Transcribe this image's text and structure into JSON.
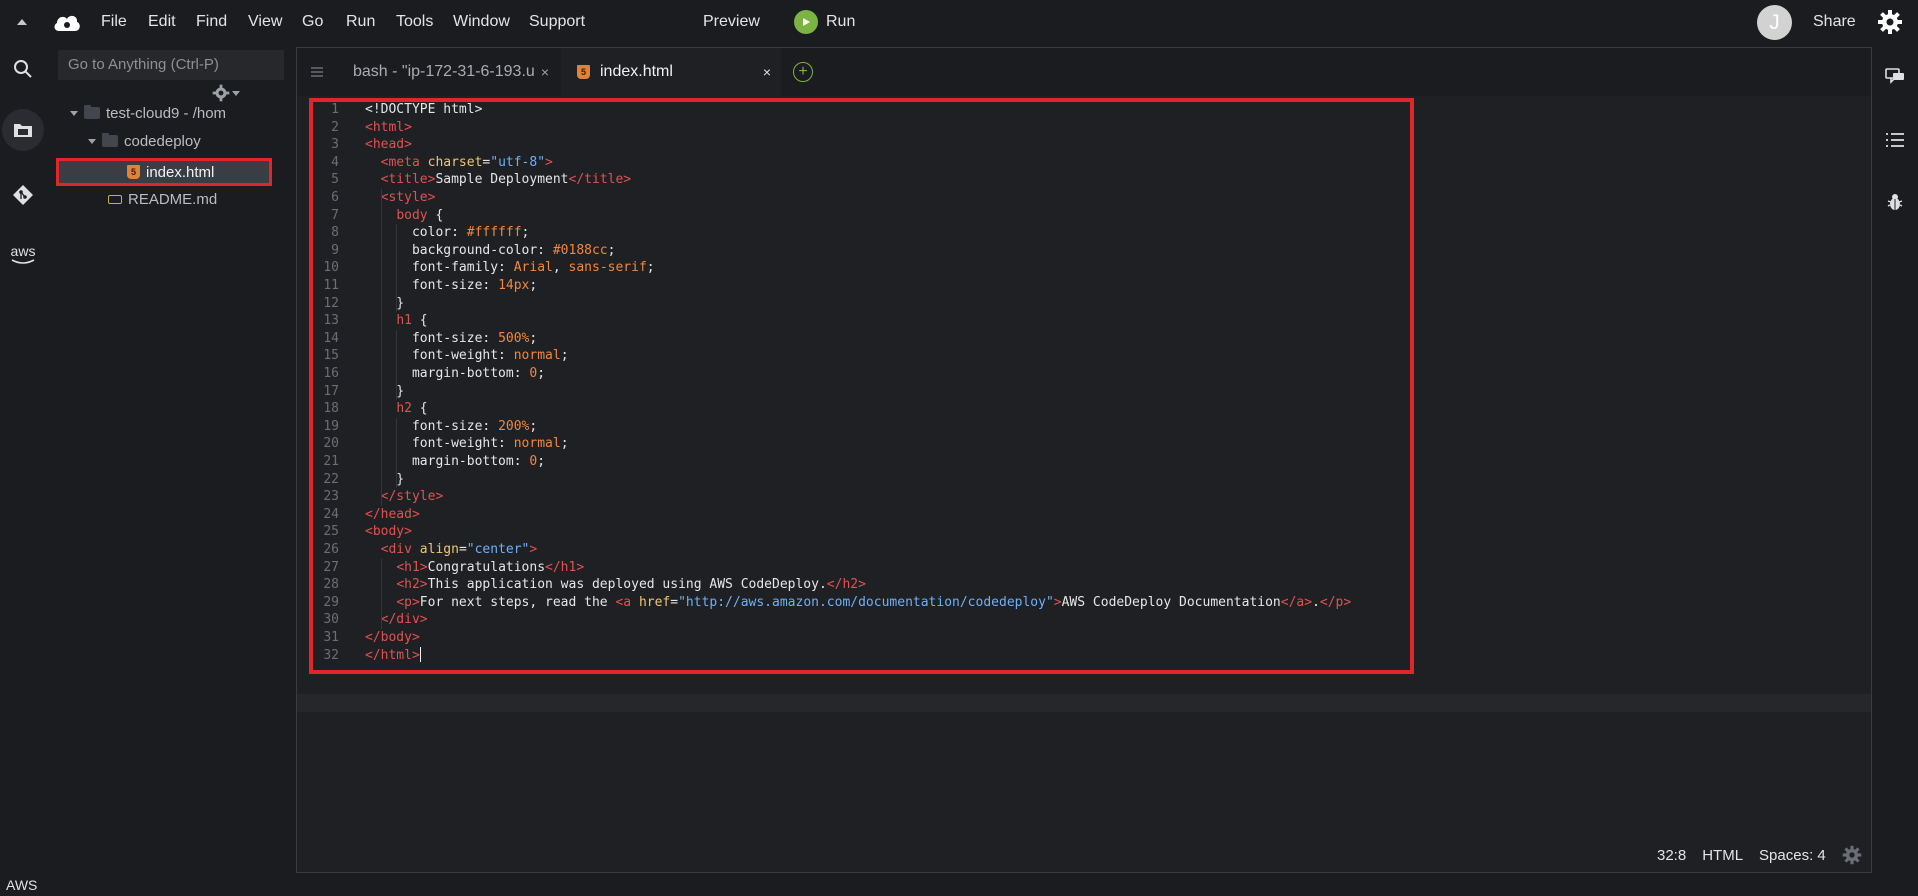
{
  "menubar": {
    "items": [
      "File",
      "Edit",
      "Find",
      "View",
      "Go",
      "Run",
      "Tools",
      "Window",
      "Support"
    ],
    "preview_label": "Preview",
    "run_label": "Run",
    "avatar_initial": "J",
    "share_label": "Share"
  },
  "tree": {
    "goto_placeholder": "Go to Anything (Ctrl-P)",
    "root_label": "test-cloud9 - /hom",
    "folder_label": "codedeploy",
    "file_selected": "index.html",
    "file_other": "README.md"
  },
  "tabs": {
    "bash_label": "bash - \"ip-172-31-6-193.u",
    "index_label": "index.html",
    "close_glyph": "×",
    "add_glyph": "+"
  },
  "code": {
    "line_numbers": [
      "1",
      "2",
      "3",
      "4",
      "5",
      "6",
      "7",
      "8",
      "9",
      "10",
      "11",
      "12",
      "13",
      "14",
      "15",
      "16",
      "17",
      "18",
      "19",
      "20",
      "21",
      "22",
      "23",
      "24",
      "25",
      "26",
      "27",
      "28",
      "29",
      "30",
      "31",
      "32"
    ],
    "lines": [
      [
        {
          "t": "plain",
          "v": "<!DOCTYPE html>"
        }
      ],
      [
        {
          "t": "tag",
          "v": "<html>"
        }
      ],
      [
        {
          "t": "tag",
          "v": "<head>"
        }
      ],
      [
        {
          "t": "plain",
          "v": "  "
        },
        {
          "t": "tag",
          "v": "<meta "
        },
        {
          "t": "attr",
          "v": "charset"
        },
        {
          "t": "plain",
          "v": "="
        },
        {
          "t": "str",
          "v": "\"utf-8\""
        },
        {
          "t": "tag",
          "v": ">"
        }
      ],
      [
        {
          "t": "plain",
          "v": "  "
        },
        {
          "t": "tag",
          "v": "<title>"
        },
        {
          "t": "plain",
          "v": "Sample Deployment"
        },
        {
          "t": "tag",
          "v": "</title>"
        }
      ],
      [
        {
          "t": "plain",
          "v": "  "
        },
        {
          "t": "tag",
          "v": "<style>"
        }
      ],
      [
        {
          "t": "plain",
          "v": "    "
        },
        {
          "t": "tag",
          "v": "body"
        },
        {
          "t": "plain",
          "v": " {"
        }
      ],
      [
        {
          "t": "plain",
          "v": "      color: "
        },
        {
          "t": "num",
          "v": "#ffffff"
        },
        {
          "t": "plain",
          "v": ";"
        }
      ],
      [
        {
          "t": "plain",
          "v": "      background-color: "
        },
        {
          "t": "num",
          "v": "#0188cc"
        },
        {
          "t": "plain",
          "v": ";"
        }
      ],
      [
        {
          "t": "plain",
          "v": "      font-family: "
        },
        {
          "t": "num",
          "v": "Arial"
        },
        {
          "t": "plain",
          "v": ", "
        },
        {
          "t": "num",
          "v": "sans-serif"
        },
        {
          "t": "plain",
          "v": ";"
        }
      ],
      [
        {
          "t": "plain",
          "v": "      font-size: "
        },
        {
          "t": "num",
          "v": "14px"
        },
        {
          "t": "plain",
          "v": ";"
        }
      ],
      [
        {
          "t": "plain",
          "v": "    }"
        }
      ],
      [
        {
          "t": "plain",
          "v": "    "
        },
        {
          "t": "tag",
          "v": "h1"
        },
        {
          "t": "plain",
          "v": " {"
        }
      ],
      [
        {
          "t": "plain",
          "v": "      font-size: "
        },
        {
          "t": "num",
          "v": "500%"
        },
        {
          "t": "plain",
          "v": ";"
        }
      ],
      [
        {
          "t": "plain",
          "v": "      font-weight: "
        },
        {
          "t": "num",
          "v": "normal"
        },
        {
          "t": "plain",
          "v": ";"
        }
      ],
      [
        {
          "t": "plain",
          "v": "      margin-bottom: "
        },
        {
          "t": "num",
          "v": "0"
        },
        {
          "t": "plain",
          "v": ";"
        }
      ],
      [
        {
          "t": "plain",
          "v": "    }"
        }
      ],
      [
        {
          "t": "plain",
          "v": "    "
        },
        {
          "t": "tag",
          "v": "h2"
        },
        {
          "t": "plain",
          "v": " {"
        }
      ],
      [
        {
          "t": "plain",
          "v": "      font-size: "
        },
        {
          "t": "num",
          "v": "200%"
        },
        {
          "t": "plain",
          "v": ";"
        }
      ],
      [
        {
          "t": "plain",
          "v": "      font-weight: "
        },
        {
          "t": "num",
          "v": "normal"
        },
        {
          "t": "plain",
          "v": ";"
        }
      ],
      [
        {
          "t": "plain",
          "v": "      margin-bottom: "
        },
        {
          "t": "num",
          "v": "0"
        },
        {
          "t": "plain",
          "v": ";"
        }
      ],
      [
        {
          "t": "plain",
          "v": "    }"
        }
      ],
      [
        {
          "t": "plain",
          "v": "  "
        },
        {
          "t": "tag",
          "v": "</style>"
        }
      ],
      [
        {
          "t": "tag",
          "v": "</head>"
        }
      ],
      [
        {
          "t": "tag",
          "v": "<body>"
        }
      ],
      [
        {
          "t": "plain",
          "v": "  "
        },
        {
          "t": "tag",
          "v": "<div "
        },
        {
          "t": "attr",
          "v": "align"
        },
        {
          "t": "plain",
          "v": "="
        },
        {
          "t": "str",
          "v": "\"center\""
        },
        {
          "t": "tag",
          "v": ">"
        }
      ],
      [
        {
          "t": "plain",
          "v": "    "
        },
        {
          "t": "tag",
          "v": "<h1>"
        },
        {
          "t": "plain",
          "v": "Congratulations"
        },
        {
          "t": "tag",
          "v": "</h1>"
        }
      ],
      [
        {
          "t": "plain",
          "v": "    "
        },
        {
          "t": "tag",
          "v": "<h2>"
        },
        {
          "t": "plain",
          "v": "This application was deployed using AWS CodeDeploy."
        },
        {
          "t": "tag",
          "v": "</h2>"
        }
      ],
      [
        {
          "t": "plain",
          "v": "    "
        },
        {
          "t": "tag",
          "v": "<p>"
        },
        {
          "t": "plain",
          "v": "For next steps, read the "
        },
        {
          "t": "tag",
          "v": "<a "
        },
        {
          "t": "attr",
          "v": "href"
        },
        {
          "t": "plain",
          "v": "="
        },
        {
          "t": "str",
          "v": "\"http://aws.amazon.com/documentation/codedeploy\""
        },
        {
          "t": "tag",
          "v": ">"
        },
        {
          "t": "plain",
          "v": "AWS CodeDeploy Documentation"
        },
        {
          "t": "tag",
          "v": "</a>"
        },
        {
          "t": "plain",
          "v": "."
        },
        {
          "t": "tag",
          "v": "</p>"
        }
      ],
      [
        {
          "t": "plain",
          "v": "  "
        },
        {
          "t": "tag",
          "v": "</div>"
        }
      ],
      [
        {
          "t": "tag",
          "v": "</body>"
        }
      ],
      [
        {
          "t": "tag",
          "v": "</html>"
        }
      ]
    ]
  },
  "status": {
    "position": "32:8",
    "language": "HTML",
    "spaces": "Spaces: 4"
  },
  "footer": {
    "aws_label": "AWS",
    "aws_logo_text": "aws"
  },
  "colors": {
    "accent_red": "#e3242b",
    "run_green": "#7cb342",
    "html_icon": "#e0823a"
  },
  "icons": {
    "collapse": "chevron-up-icon",
    "logo": "cloud9-logo-icon",
    "search": "search-icon",
    "files": "folder-icon",
    "git": "git-icon",
    "settings": "gear-icon",
    "collab": "chat-icon",
    "outline": "outline-list-icon",
    "debugger": "bug-icon"
  }
}
